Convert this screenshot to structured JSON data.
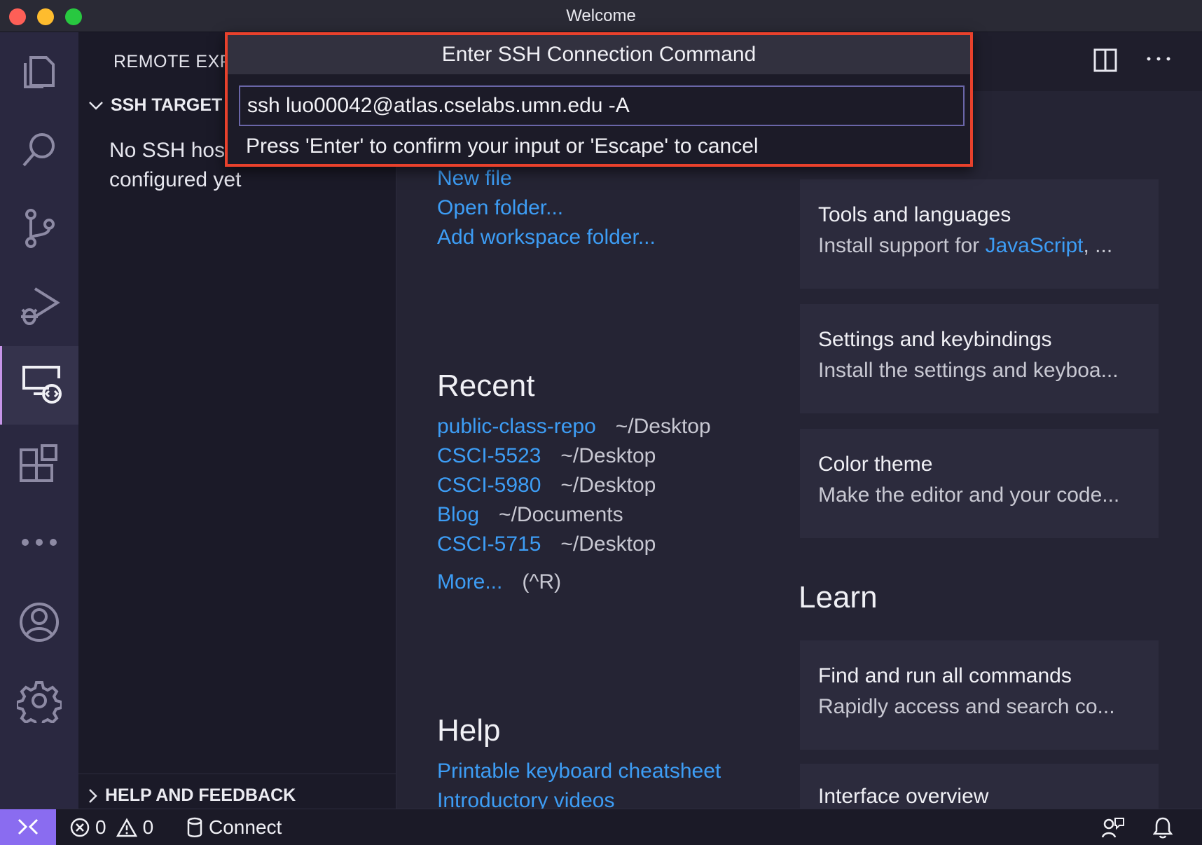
{
  "window": {
    "title": "Welcome"
  },
  "activity_bar": {
    "items": [
      {
        "name": "explorer",
        "icon": "files-icon"
      },
      {
        "name": "search",
        "icon": "search-icon"
      },
      {
        "name": "source-control",
        "icon": "source-control-icon"
      },
      {
        "name": "run-debug",
        "icon": "run-debug-icon"
      },
      {
        "name": "remote-explorer",
        "icon": "remote-explorer-icon",
        "active": true
      },
      {
        "name": "extensions",
        "icon": "extensions-icon"
      },
      {
        "name": "more",
        "icon": "ellipsis-icon"
      },
      {
        "name": "accounts",
        "icon": "account-icon"
      },
      {
        "name": "manage",
        "icon": "gear-icon"
      }
    ]
  },
  "sidebar": {
    "title": "REMOTE EXP",
    "section": "SSH TARGET",
    "message": "No SSH hos configured yet",
    "footer": "HELP AND FEEDBACK"
  },
  "quick_input": {
    "title": "Enter SSH Connection Command",
    "value": "ssh luo00042@atlas.cselabs.umn.edu -A",
    "hint": "Press 'Enter' to confirm your input or 'Escape' to cancel",
    "highlight_color": "#e8412c"
  },
  "welcome": {
    "start_links": [
      "New file",
      "Open folder...",
      "Add workspace folder..."
    ],
    "recent_heading": "Recent",
    "recent": [
      {
        "name": "public-class-repo",
        "path": "~/Desktop"
      },
      {
        "name": "CSCI-5523",
        "path": "~/Desktop"
      },
      {
        "name": "CSCI-5980",
        "path": "~/Desktop"
      },
      {
        "name": "Blog",
        "path": "~/Documents"
      },
      {
        "name": "CSCI-5715",
        "path": "~/Desktop"
      }
    ],
    "more_link": "More...",
    "more_shortcut": "(^R)",
    "help_heading": "Help",
    "help_links": [
      "Printable keyboard cheatsheet",
      "Introductory videos"
    ],
    "customize_cards": [
      {
        "title": "Tools and languages",
        "desc_prefix": "Install support for ",
        "desc_link": "JavaScript",
        "desc_suffix": ", ..."
      },
      {
        "title": "Settings and keybindings",
        "desc": "Install the settings and keyboa..."
      },
      {
        "title": "Color theme",
        "desc": "Make the editor and your code..."
      }
    ],
    "learn_heading": "Learn",
    "learn_cards": [
      {
        "title": "Find and run all commands",
        "desc": "Rapidly access and search co..."
      },
      {
        "title": "Interface overview",
        "desc": ""
      }
    ]
  },
  "status_bar": {
    "errors": "0",
    "warnings": "0",
    "connect_label": "Connect"
  },
  "colors": {
    "accent": "#8a6cf0",
    "link": "#3d9df5",
    "highlight_border": "#e8412c"
  }
}
